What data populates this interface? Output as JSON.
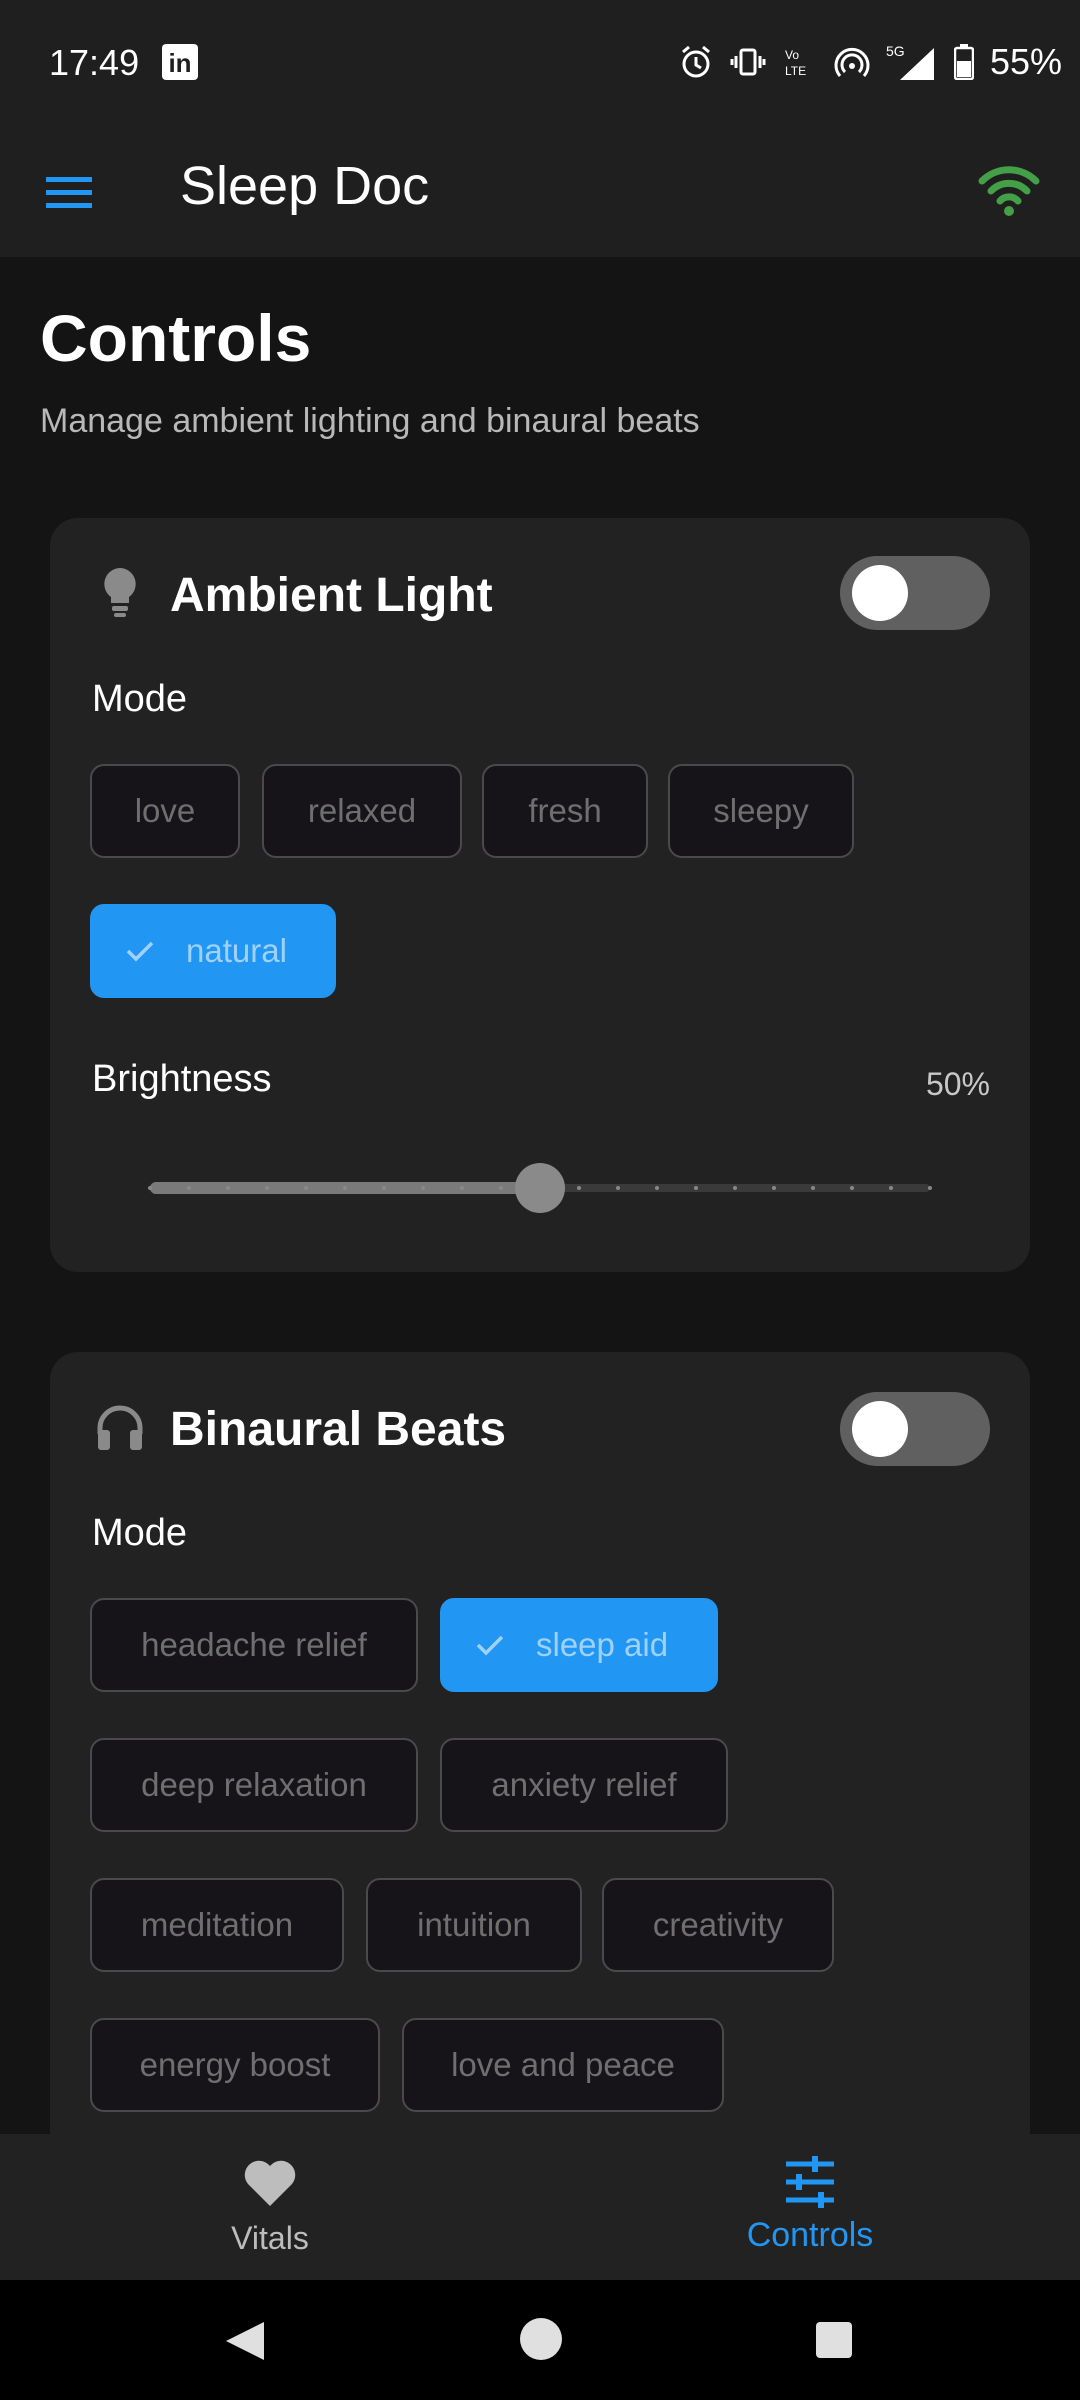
{
  "status_bar": {
    "time": "17:49",
    "linkedin": "in",
    "network": "5G",
    "battery": "55%"
  },
  "app_bar": {
    "title": "Sleep Doc",
    "accent_color": "#2196f3",
    "connected_color": "#43a047"
  },
  "page": {
    "title": "Controls",
    "subtitle": "Manage ambient lighting and binaural beats"
  },
  "ambient_light": {
    "title": "Ambient Light",
    "enabled": false,
    "mode_label": "Mode",
    "modes": [
      "love",
      "relaxed",
      "fresh",
      "sleepy",
      "natural"
    ],
    "selected_mode": "natural",
    "brightness_label": "Brightness",
    "brightness_value": "50%",
    "brightness_level": 0.5
  },
  "binaural_beats": {
    "title": "Binaural Beats",
    "enabled": false,
    "mode_label": "Mode",
    "modes": [
      "headache relief",
      "sleep aid",
      "deep relaxation",
      "anxiety relief",
      "meditation",
      "intuition",
      "creativity",
      "energy boost",
      "love and peace"
    ],
    "selected_mode": "sleep aid"
  },
  "bottom_nav": {
    "items": [
      {
        "label": "Vitals",
        "icon": "heart-icon",
        "active": false
      },
      {
        "label": "Controls",
        "icon": "sliders-icon",
        "active": true
      }
    ]
  }
}
